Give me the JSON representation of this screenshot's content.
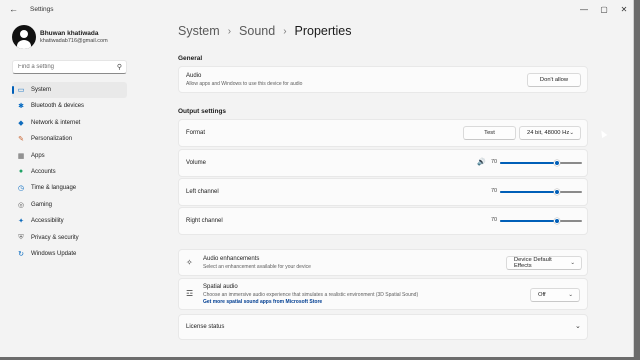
{
  "titlebar": {
    "title": "Settings",
    "back_icon": "back-arrow-icon",
    "minimize": "—",
    "maximize": "▢",
    "close": "✕"
  },
  "profile": {
    "name": "Bhuwan khatiwada",
    "email": "khatiwadab716@gmail.com"
  },
  "search": {
    "placeholder": "Find a setting"
  },
  "sidebar": {
    "items": [
      {
        "label": "System",
        "icon": "▭",
        "color": "#0067c0"
      },
      {
        "label": "Bluetooth & devices",
        "icon": "✱",
        "color": "#0067c0"
      },
      {
        "label": "Network & internet",
        "icon": "◆",
        "color": "#0f6cbd"
      },
      {
        "label": "Personalization",
        "icon": "✎",
        "color": "#c8602b"
      },
      {
        "label": "Apps",
        "icon": "▦",
        "color": "#5a5a5a"
      },
      {
        "label": "Accounts",
        "icon": "●",
        "color": "#21a366"
      },
      {
        "label": "Time & language",
        "icon": "◷",
        "color": "#0067c0"
      },
      {
        "label": "Gaming",
        "icon": "◎",
        "color": "#5a5a5a"
      },
      {
        "label": "Accessibility",
        "icon": "✦",
        "color": "#0f6cbd"
      },
      {
        "label": "Privacy & security",
        "icon": "⛨",
        "color": "#6b6b6b"
      },
      {
        "label": "Windows Update",
        "icon": "↻",
        "color": "#0067c0"
      }
    ]
  },
  "breadcrumb": {
    "level1": "System",
    "level2": "Sound",
    "level3": "Properties",
    "separator": "›"
  },
  "general": {
    "title": "General",
    "audio_label": "Audio",
    "audio_desc": "Allow apps and Windows to use this device for audio",
    "dont_allow": "Don't allow"
  },
  "output": {
    "title": "Output settings",
    "format_label": "Format",
    "test_button": "Test",
    "format_value": "24 bit, 48000 Hz",
    "volume_label": "Volume",
    "volume_value": "70",
    "left_label": "Left channel",
    "left_value": "70",
    "right_label": "Right channel",
    "right_value": "70",
    "speaker_icon": "🔊"
  },
  "enhancements": {
    "label": "Audio enhancements",
    "desc": "Select an enhancement available for your device",
    "value": "Device Default Effects"
  },
  "spatial": {
    "label": "Spatial audio",
    "desc": "Choose an immersive audio experience that simulates a realistic environment (3D Spatial Sound)",
    "link": "Get more spatial sound apps from Microsoft Store",
    "value": "Off"
  },
  "license": {
    "label": "License status"
  },
  "colors": {
    "accent": "#005fb8"
  },
  "sliders": {
    "volume": 0.7,
    "left": 0.7,
    "right": 0.7
  }
}
